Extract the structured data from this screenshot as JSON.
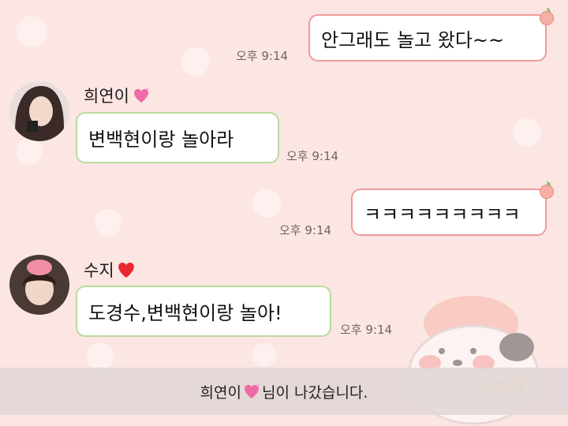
{
  "messages": [
    {
      "text": "안그래도 놀고 왔다~~",
      "time": "오후 9:14"
    },
    {
      "sender": "희연이",
      "text": "변백현이랑 놀아라",
      "time": "오후 9:14"
    },
    {
      "text": "ㅋㅋㅋㅋㅋㅋㅋㅋㅋ",
      "time": "오후 9:14"
    },
    {
      "sender": "수지",
      "text": "도경수,변백현이랑 놀아!",
      "time": "오후 9:14"
    }
  ],
  "notice": {
    "name": "희연이",
    "suffix": "님이 나갔습니다."
  },
  "icons": {
    "sparkle_heart": "sparkling-heart-icon",
    "red_heart": "red-heart-icon",
    "peach": "peach-icon"
  },
  "colors": {
    "background": "#fbe6e4",
    "outgoing_border": "#ef9a9a",
    "incoming_border": "#b9da9c"
  }
}
